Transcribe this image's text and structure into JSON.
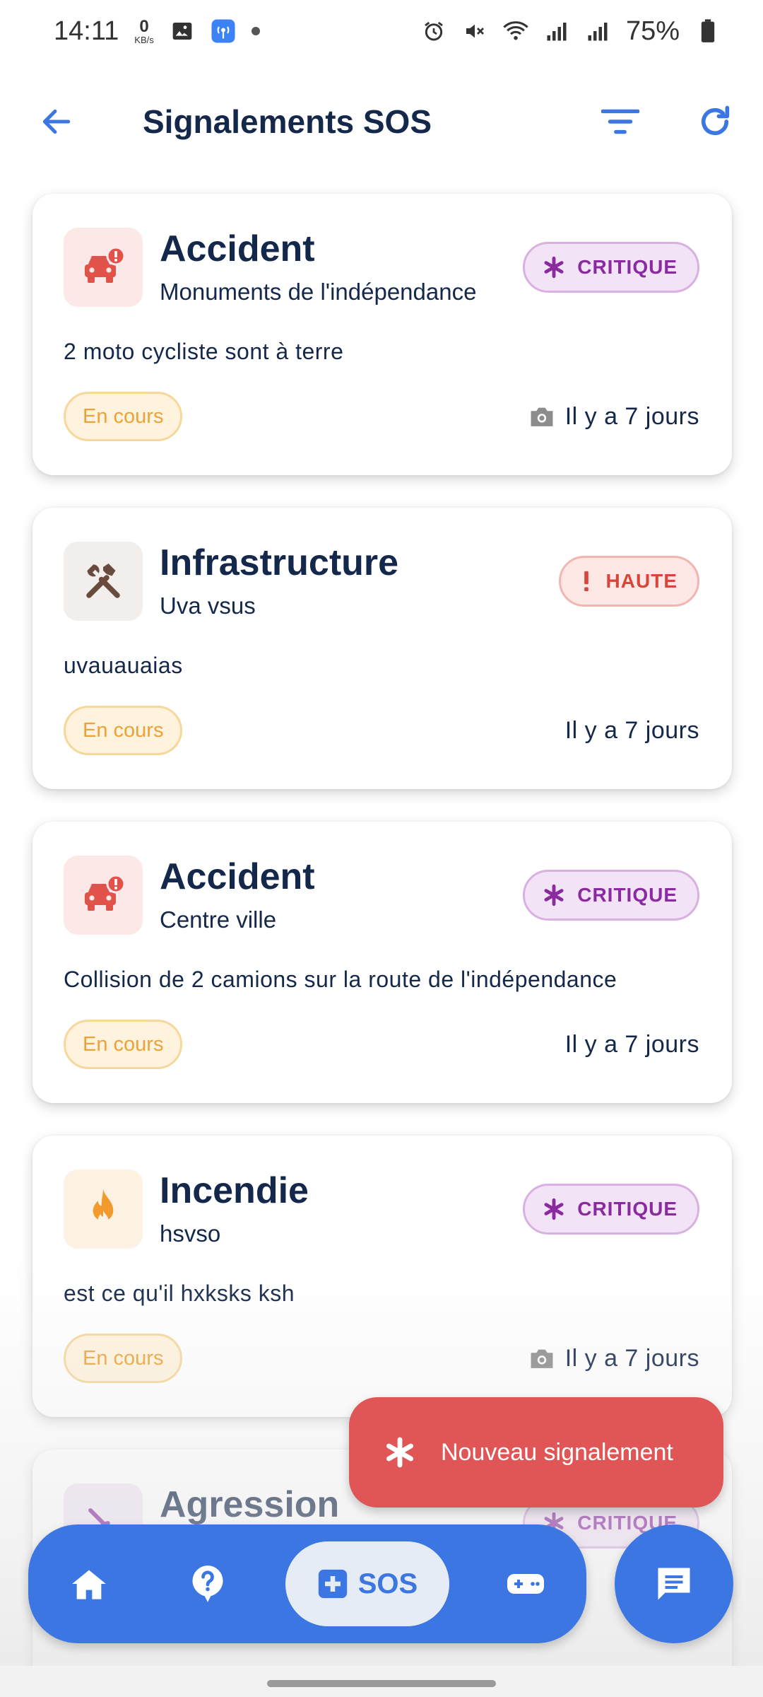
{
  "status_bar": {
    "time": "14:11",
    "net_speed_value": "0",
    "net_speed_unit": "KB/s",
    "battery": "75%",
    "icons": [
      "image-icon",
      "hotspot-icon",
      "alarm-icon",
      "mute-icon",
      "wifi-icon",
      "signal-icon",
      "signal-icon",
      "battery-icon"
    ]
  },
  "header": {
    "title": "Signalements SOS",
    "icons": [
      "back-arrow-icon",
      "filter-icon",
      "refresh-icon"
    ]
  },
  "reports": [
    {
      "category": "Accident",
      "location": "Monuments de l'indépendance",
      "description": "2 moto cycliste sont à terre",
      "priority": "CRITIQUE",
      "status": "En cours",
      "time": "Il y a 7 jours",
      "has_photo": true,
      "icon": "car-crash-icon"
    },
    {
      "category": "Infrastructure",
      "location": "Uva vsus",
      "description": "uvauauaias",
      "priority": "HAUTE",
      "status": "En cours",
      "time": "Il y a 7 jours",
      "has_photo": false,
      "icon": "tools-icon"
    },
    {
      "category": "Accident",
      "location": "Centre ville",
      "description": "Collision de 2 camions sur la route de l'indépendance",
      "priority": "CRITIQUE",
      "status": "En cours",
      "time": "Il y a 7 jours",
      "has_photo": false,
      "icon": "car-crash-icon"
    },
    {
      "category": "Incendie",
      "location": "hsvso",
      "description": "est ce qu'il hxksks ksh",
      "priority": "CRITIQUE",
      "status": "En cours",
      "time": "Il y a 7 jours",
      "has_photo": true,
      "icon": "fire-icon"
    },
    {
      "category": "Agression",
      "priority": "CRITIQUE",
      "icon": "agression-icon"
    }
  ],
  "fab": {
    "label": "Nouveau signalement"
  },
  "bottom_nav": {
    "items": [
      "home-icon",
      "help-icon",
      "sos-icon",
      "gamepad-icon"
    ],
    "sos_label": "SOS",
    "chat_icon": "chat-icon"
  },
  "colors": {
    "primary": "#3b76e2",
    "title": "#14284b",
    "critique": "#8a2aa1",
    "haute": "#d8453a",
    "status": "#eca23a",
    "fab": "#e05656"
  }
}
